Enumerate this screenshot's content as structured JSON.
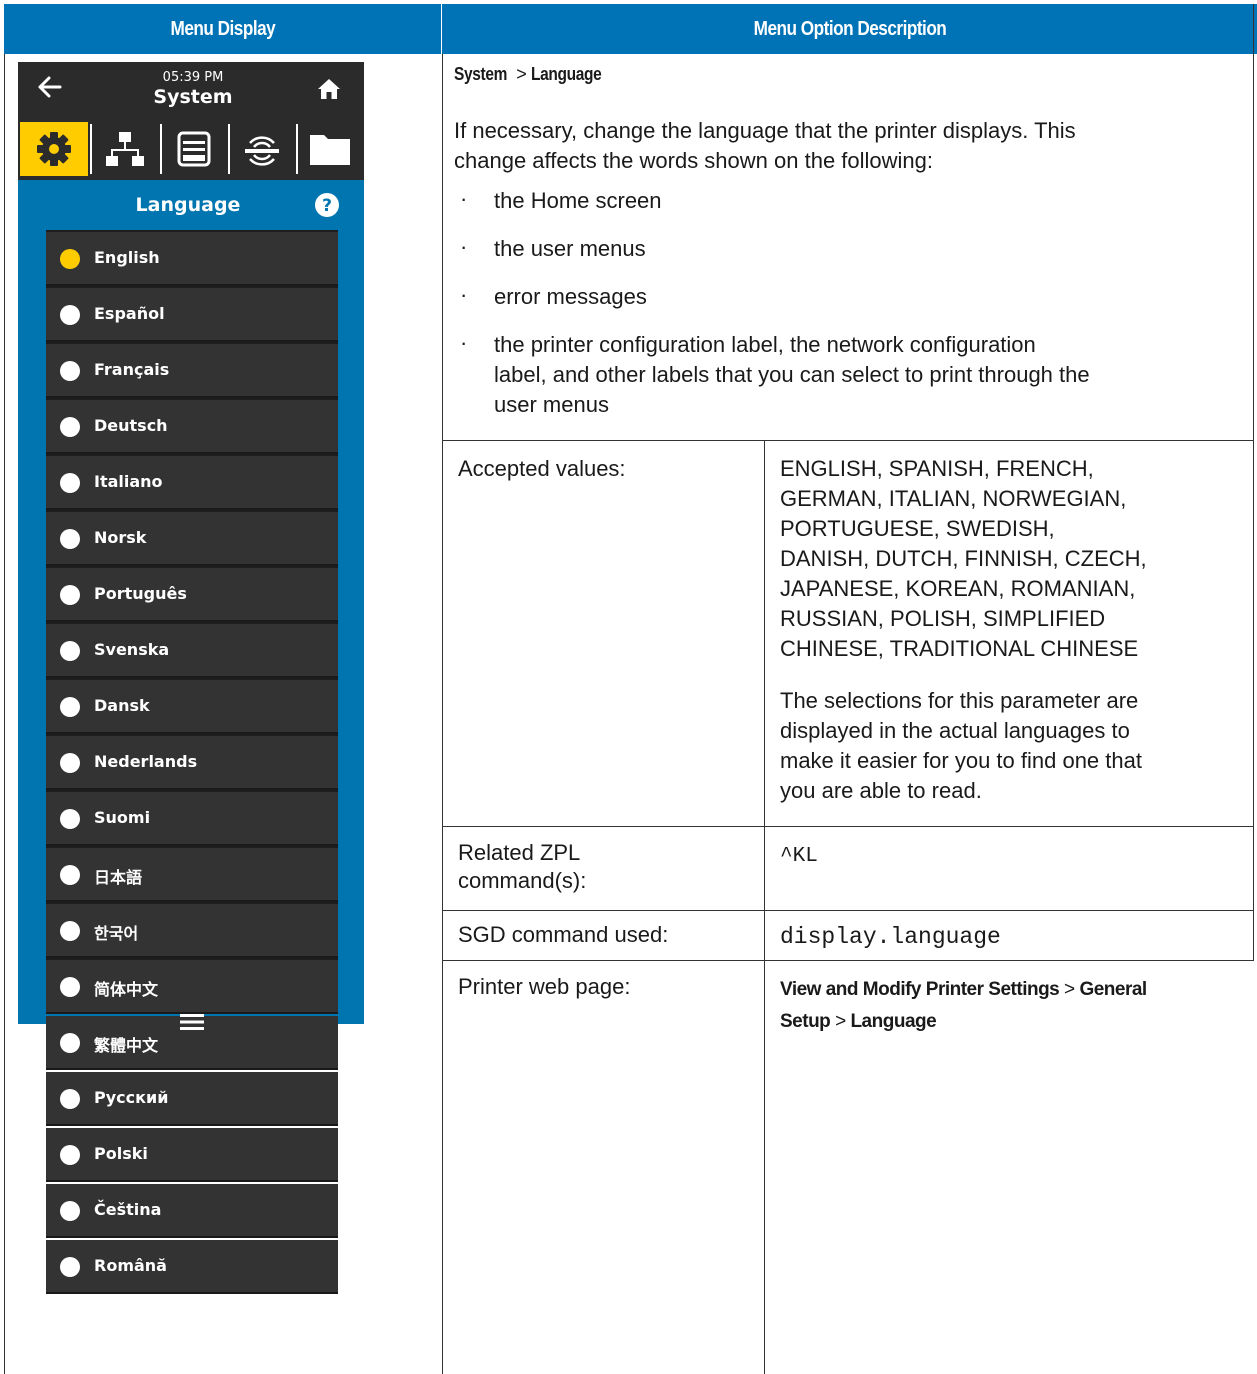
{
  "table_header": {
    "menu_display": "Menu Display",
    "menu_option_description": "Menu Option Description"
  },
  "printer_display": {
    "time": "05:39 PM",
    "title": "System",
    "section_title": "Language",
    "languages": [
      {
        "label": "English",
        "selected": true
      },
      {
        "label": "Español",
        "selected": false
      },
      {
        "label": "Français",
        "selected": false
      },
      {
        "label": "Deutsch",
        "selected": false
      },
      {
        "label": "Italiano",
        "selected": false
      },
      {
        "label": "Norsk",
        "selected": false
      },
      {
        "label": "Português",
        "selected": false
      },
      {
        "label": "Svenska",
        "selected": false
      },
      {
        "label": "Dansk",
        "selected": false
      },
      {
        "label": "Nederlands",
        "selected": false
      },
      {
        "label": "Suomi",
        "selected": false
      },
      {
        "label": "日本語",
        "selected": false
      },
      {
        "label": "한국어",
        "selected": false
      },
      {
        "label": "简体中文",
        "selected": false
      },
      {
        "label": "繁體中文",
        "selected": false
      },
      {
        "label": "Русский",
        "selected": false
      },
      {
        "label": "Polski",
        "selected": false
      },
      {
        "label": "Čeština",
        "selected": false
      },
      {
        "label": "Română",
        "selected": false
      }
    ],
    "colors": {
      "accent": "#ffcc00",
      "screen_bg": "#0075b0",
      "bar_bg": "#2b2b2b",
      "header_blue": "#0073b7"
    }
  },
  "description": {
    "path_part1": "System",
    "path_sep": ">",
    "path_part2": "Language",
    "intro_line1": "If necessary, change the language that the printer displays. This",
    "intro_line2": "change affects the words shown on the following:",
    "bullets": [
      [
        "the Home screen"
      ],
      [
        "the user menus"
      ],
      [
        "error messages"
      ],
      [
        "the printer configuration label, the network configuration",
        "label, and other labels that you can select to print through the",
        "user menus"
      ]
    ],
    "bullet_char": "·",
    "accepted_label": "Accepted values:",
    "accepted_values_lines": [
      "ENGLISH, SPANISH, FRENCH,",
      "GERMAN, ITALIAN, NORWEGIAN,",
      "PORTUGUESE, SWEDISH,",
      "DANISH, DUTCH, FINNISH, CZECH,",
      "JAPANESE, KOREAN, ROMANIAN,",
      "RUSSIAN, POLISH, SIMPLIFIED",
      "CHINESE, TRADITIONAL CHINESE"
    ],
    "accepted_note_lines": [
      "The selections for this parameter are",
      "displayed in the actual languages to",
      "make it easier for you to find one that",
      "you are able to read."
    ],
    "zpl_label_line1": "Related ZPL",
    "zpl_label_line2": "command(s):",
    "zpl_value": "^KL",
    "sgd_label": "SGD command used:",
    "sgd_value": "display.language",
    "web_label": "Printer web page:",
    "web_part1": "View and Modify Printer Settings",
    "web_sep1": ">",
    "web_part2": "General",
    "web_part3": "Setup",
    "web_sep2": ">",
    "web_part4": "Language"
  }
}
